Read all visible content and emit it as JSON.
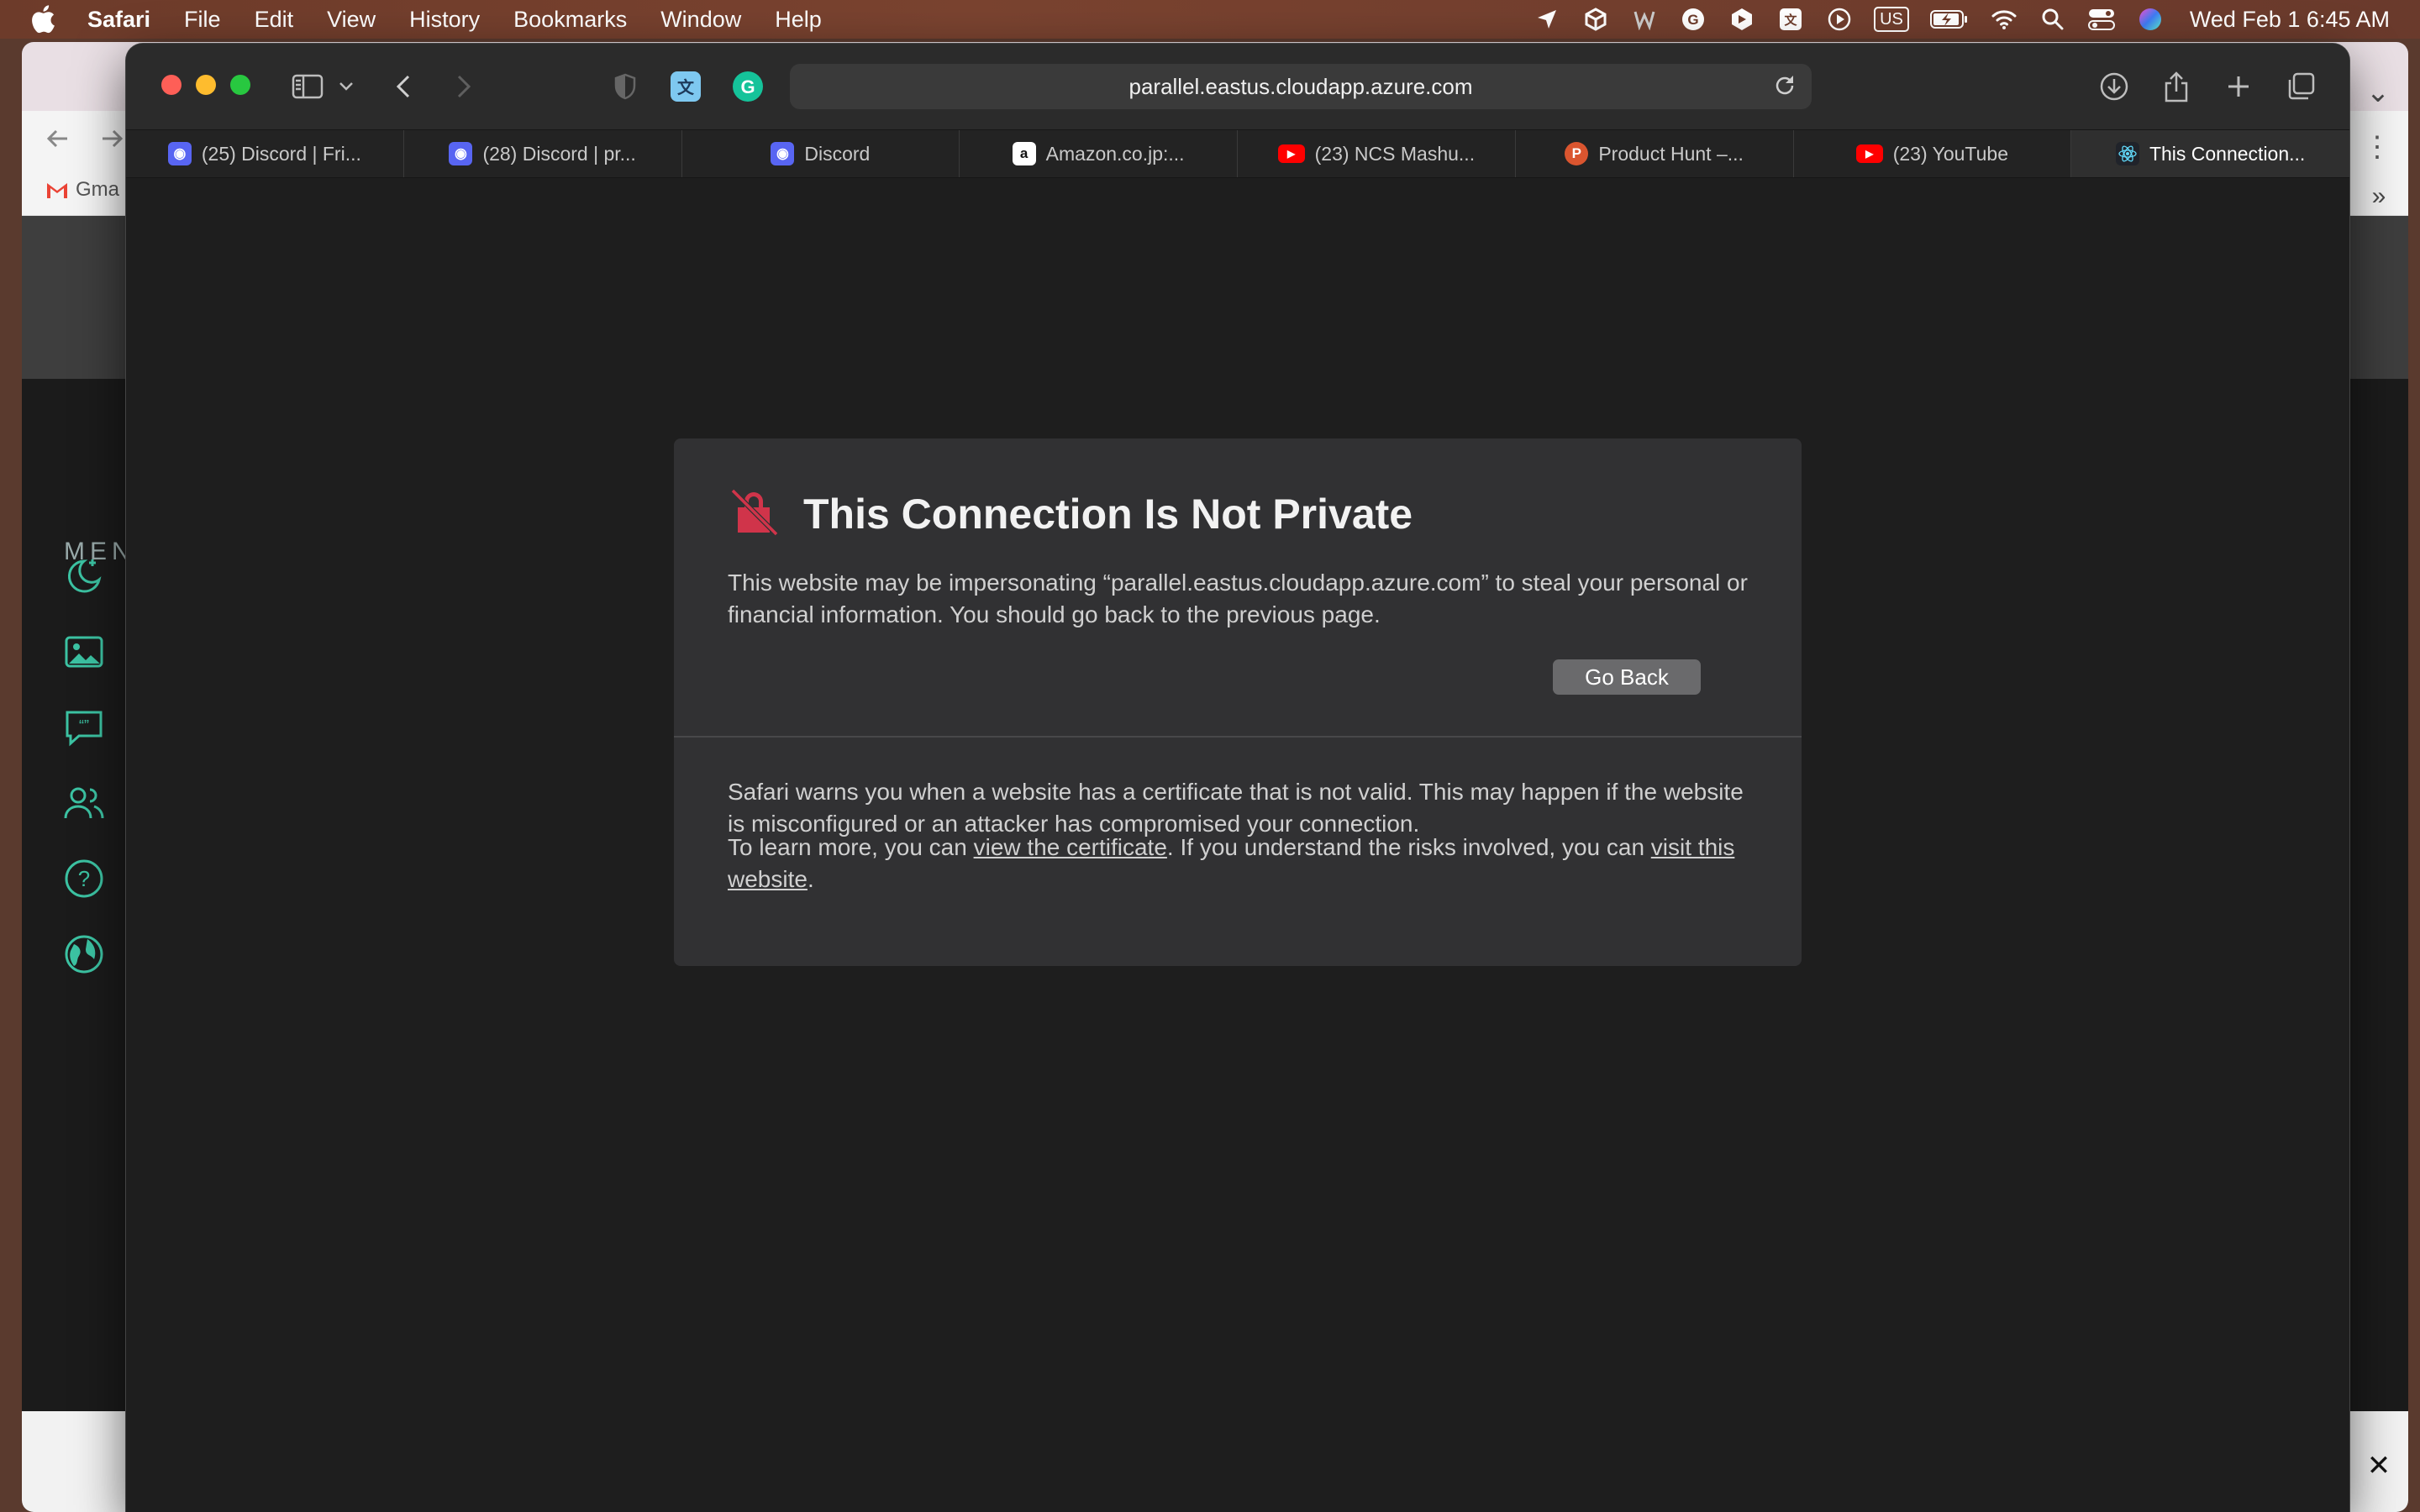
{
  "menubar": {
    "app_name": "Safari",
    "menus": [
      "File",
      "Edit",
      "View",
      "History",
      "Bookmarks",
      "Window",
      "Help"
    ],
    "input_source": "US",
    "clock": "Wed Feb 1  6:45 AM"
  },
  "background_window": {
    "bookmark_label": "Gma",
    "menu_label": "MEN"
  },
  "safari": {
    "url": "parallel.eastus.cloudapp.azure.com",
    "tabs": [
      {
        "label": "(25) Discord | Fri...",
        "favicon": "discord-icon",
        "color": "#5865f2"
      },
      {
        "label": "(28) Discord | pr...",
        "favicon": "discord-icon",
        "color": "#5865f2"
      },
      {
        "label": "Discord",
        "favicon": "discord-icon",
        "color": "#5865f2"
      },
      {
        "label": "Amazon.co.jp:...",
        "favicon": "amazon-icon",
        "color": "#ffffff"
      },
      {
        "label": "(23) NCS Mashu...",
        "favicon": "youtube-icon",
        "color": "#ff0000"
      },
      {
        "label": "Product Hunt –...",
        "favicon": "producthunt-icon",
        "color": "#da552f"
      },
      {
        "label": "(23) YouTube",
        "favicon": "youtube-icon",
        "color": "#ff0000"
      },
      {
        "label": "This Connection...",
        "favicon": "react-icon",
        "color": "#61dafb"
      }
    ]
  },
  "error_page": {
    "title": "This Connection Is Not Private",
    "message": "This website may be impersonating “parallel.eastus.cloudapp.azure.com” to steal your personal or financial information. You should go back to the previous page.",
    "go_back_label": "Go Back",
    "explanation": "Safari warns you when a website has a certificate that is not valid. This may happen if the website is misconfigured or an attacker has compromised your connection.",
    "learn_more_prefix": "To learn more, you can ",
    "view_certificate_link": "view the certificate",
    "learn_more_middle": ". If you understand the risks involved, you can ",
    "visit_website_link": "visit this website",
    "learn_more_suffix": "."
  },
  "colors": {
    "warning_icon": "#d0344a",
    "traffic_close": "#fe5f57",
    "traffic_minimize": "#febc2e",
    "traffic_zoom": "#28c840"
  }
}
